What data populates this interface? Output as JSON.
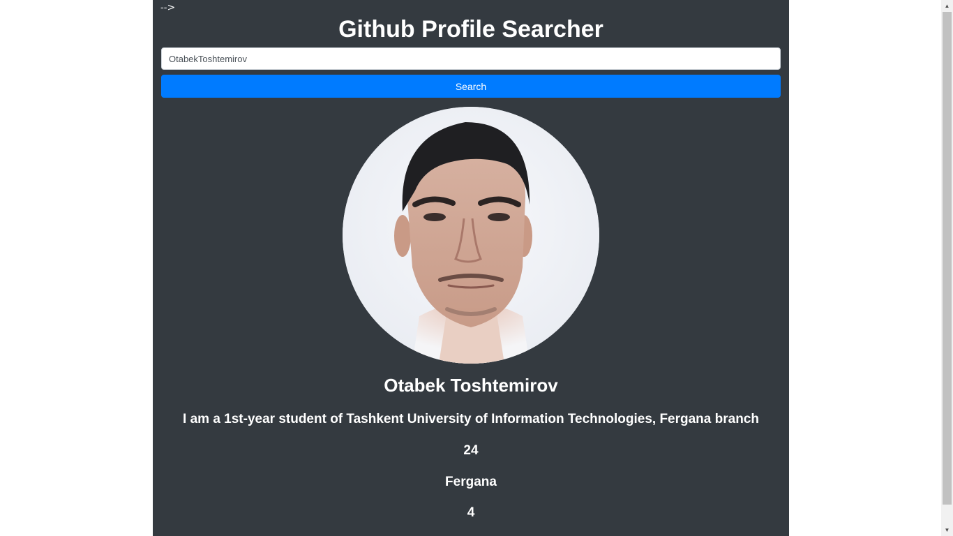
{
  "page": {
    "stray_text": "-->",
    "title": "Github Profile Searcher"
  },
  "search": {
    "value": "OtabekToshtemirov",
    "button_label": "Search"
  },
  "profile": {
    "name": "Otabek Toshtemirov",
    "bio": "I am a 1st-year student of Tashkent University of Information Technologies, Fergana branch",
    "stats": [
      "24",
      "Fergana",
      "4"
    ]
  },
  "colors": {
    "container_bg": "#343a40",
    "button_bg": "#007bff",
    "text": "#ffffff"
  },
  "scrollbar": {
    "up_icon": "triangle-up-icon",
    "down_icon": "triangle-down-icon",
    "position_fraction": 0.97
  }
}
